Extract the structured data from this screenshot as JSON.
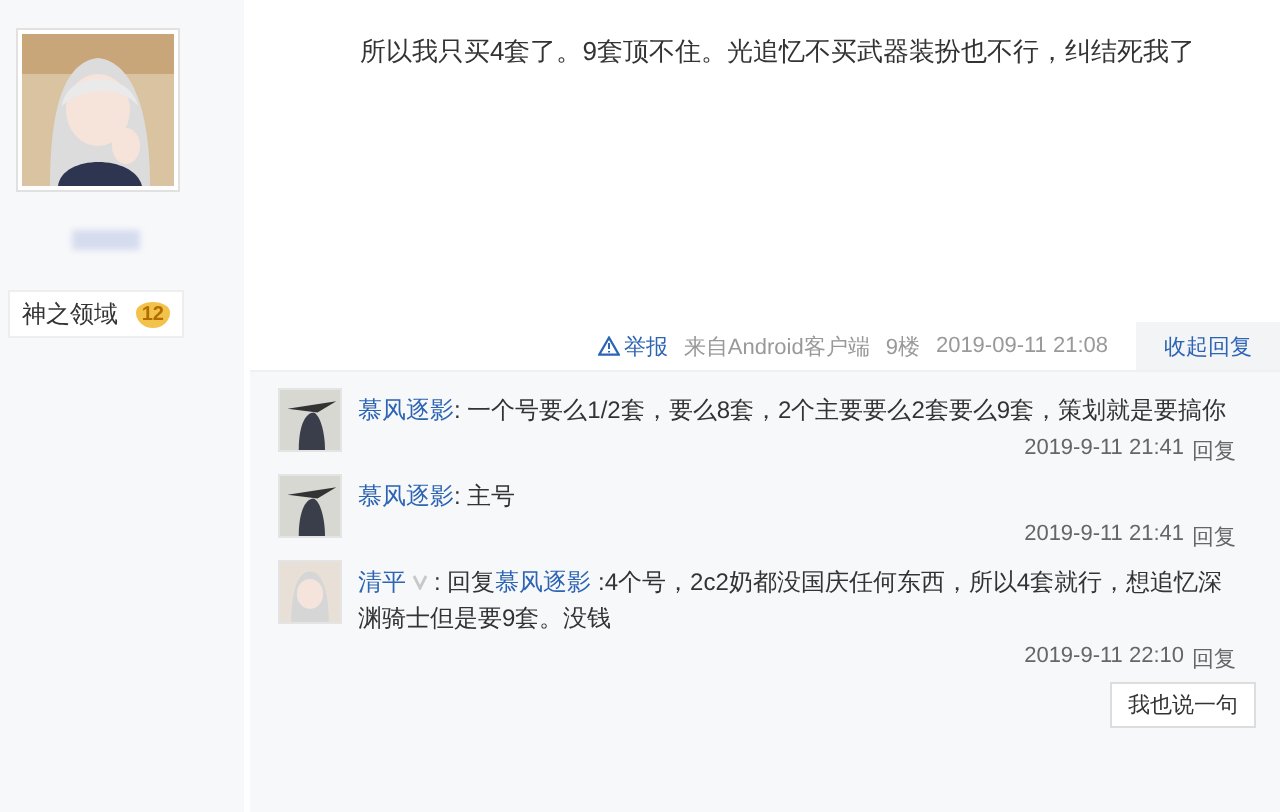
{
  "author": {
    "badge": {
      "title": "神之领域",
      "level": "12"
    }
  },
  "post": {
    "text": "所以我只买4套了。9套顶不住。光追忆不买武器装扮也不行，纠结死我了",
    "footer": {
      "report": "举报",
      "source": "来自Android客户端",
      "floor": "9楼",
      "time": "2019-09-11 21:08",
      "toggle": "收起回复"
    }
  },
  "replies": [
    {
      "author": "慕风逐影",
      "has_badge": false,
      "text": ": 一个号要么1/2套，要么8套，2个主要要么2套要么9套，策划就是要搞你",
      "time": "2019-9-11 21:41",
      "action": "回复"
    },
    {
      "author": "慕风逐影",
      "has_badge": false,
      "text": ": 主号",
      "time": "2019-9-11 21:41",
      "action": "回复"
    },
    {
      "author": "清平",
      "has_badge": true,
      "prefix": ": 回复",
      "reply_to": "慕风逐影",
      "text": " :4个号，2c2奶都没国庆任何东西，所以4套就行，想追忆深渊骑士但是要9套。没钱",
      "time": "2019-9-11 22:10",
      "action": "回复"
    }
  ],
  "reply_button": "我也说一句"
}
